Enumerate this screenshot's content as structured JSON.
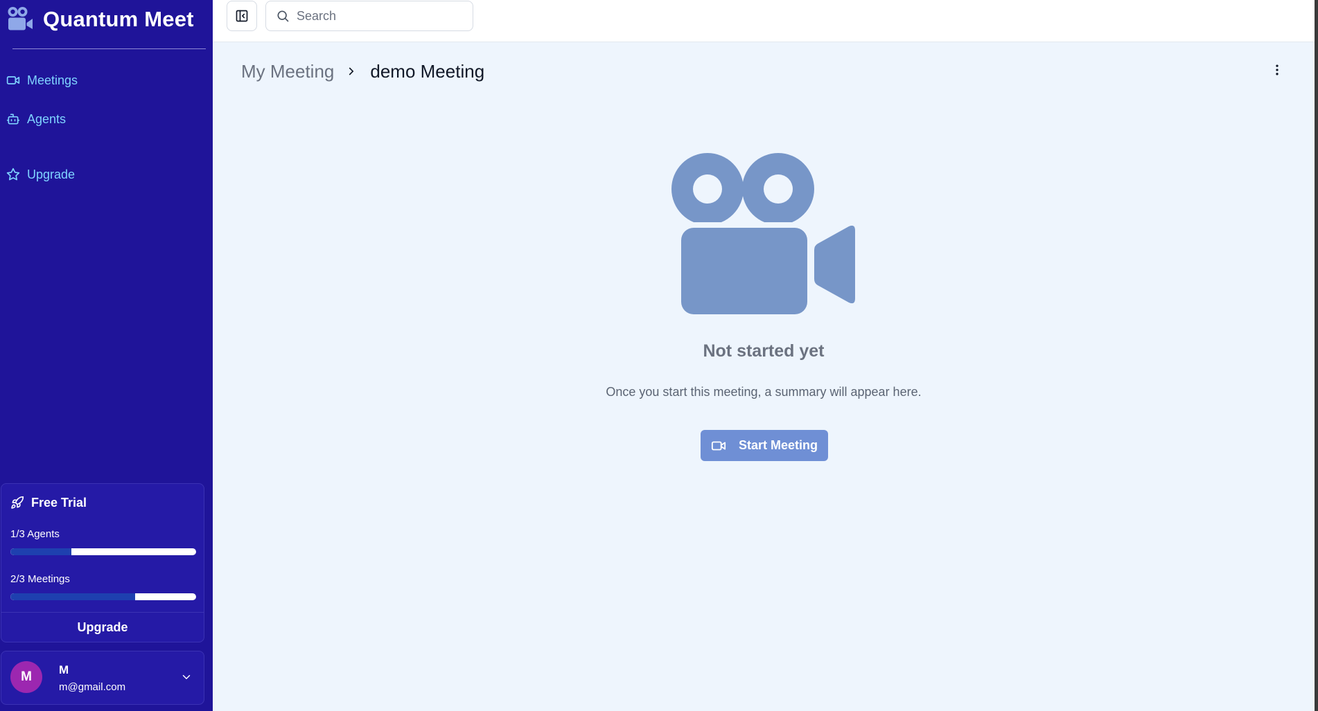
{
  "app": {
    "title": "Quantum Meet"
  },
  "sidebar": {
    "nav": [
      {
        "label": "Meetings",
        "icon": "video-icon"
      },
      {
        "label": "Agents",
        "icon": "bot-icon"
      },
      {
        "label": "Upgrade",
        "icon": "star-icon"
      }
    ],
    "trial": {
      "title": "Free Trial",
      "icon": "rocket-icon",
      "usage": [
        {
          "label": "1/3 Agents",
          "progress": 0.33
        },
        {
          "label": "2/3 Meetings",
          "progress": 0.67
        }
      ],
      "upgrade_label": "Upgrade"
    },
    "user": {
      "initial": "M",
      "name": "M",
      "email": "m@gmail.com"
    }
  },
  "topbar": {
    "search": {
      "placeholder": "Search",
      "value": ""
    }
  },
  "main": {
    "breadcrumb": {
      "parent": "My Meeting",
      "current": "demo Meeting"
    },
    "empty_state": {
      "title": "Not started yet",
      "description": "Once you start this meeting, a summary will appear here.",
      "button_label": "Start Meeting"
    }
  },
  "colors": {
    "sidebar_bg": "#1f1499",
    "nav_text": "#7fd3ff",
    "brand_icon": "#8fa8e8",
    "main_bg": "#eef5fd",
    "illustration": "#7796c8",
    "button_bg": "#6f8fd5",
    "avatar_bg": "#9c27b0",
    "progress_fill": "#1e40af"
  }
}
